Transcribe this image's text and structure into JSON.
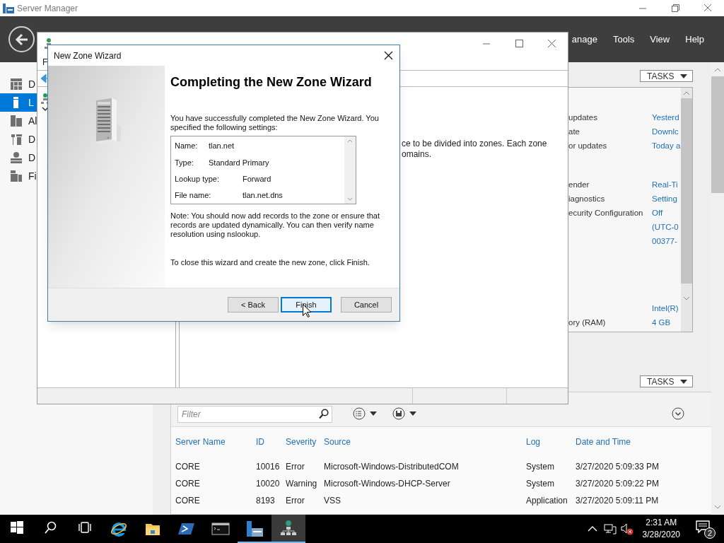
{
  "server_manager": {
    "title": "Server Manager",
    "menu": [
      "anage",
      "Tools",
      "View",
      "Help"
    ],
    "sidebar": [
      {
        "kind": "dashboard",
        "label": "D",
        "selected": false
      },
      {
        "kind": "local",
        "label": "L",
        "selected": true
      },
      {
        "kind": "all",
        "label": "Al",
        "selected": false
      },
      {
        "kind": "dhcp",
        "label": "D",
        "selected": false
      },
      {
        "kind": "dns",
        "label": "D",
        "selected": false
      },
      {
        "kind": "files",
        "label": "Fi",
        "selected": false
      }
    ],
    "properties_tasks": "TASKS",
    "properties": [
      [
        {
          "label": "updates",
          "value": "Yesterd"
        },
        {
          "label": "ate",
          "value": "Downlc"
        },
        {
          "label": "or updates",
          "value": "Today a"
        }
      ],
      [
        {
          "label": "ender",
          "value": "Real-Ti"
        },
        {
          "label": "iagnostics",
          "value": "Setting"
        },
        {
          "label": "ecurity Configuration",
          "value": "Off"
        },
        {
          "value": "(UTC-0"
        },
        {
          "value": "00377-"
        }
      ],
      [
        {
          "value": "Intel(R)"
        },
        {
          "label": "ory (RAM)",
          "value": "4 GB"
        }
      ]
    ],
    "events_tasks": "TASKS",
    "events": {
      "filter_placeholder": "Filter",
      "columns": [
        "Server Name",
        "ID",
        "Severity",
        "Source",
        "Log",
        "Date and Time"
      ],
      "rows": [
        [
          "CORE",
          "10016",
          "Error",
          "Microsoft-Windows-DistributedCOM",
          "System",
          "3/27/2020 5:09:33 PM"
        ],
        [
          "CORE",
          "10020",
          "Warning",
          "Microsoft-Windows-DHCP-Server",
          "System",
          "3/27/2020 5:09:22 PM"
        ],
        [
          "CORE",
          "8193",
          "Error",
          "VSS",
          "Application",
          "3/27/2020 5:09:11 PM"
        ]
      ]
    }
  },
  "dns_manager": {
    "menu": [
      "F"
    ],
    "details_text": [
      "ce to be divided into zones. Each zone",
      "omains."
    ]
  },
  "wizard": {
    "title": "New Zone Wizard",
    "heading": "Completing the New Zone Wizard",
    "intro": "You have successfully completed the New Zone Wizard. You specified the following settings:",
    "settings": [
      {
        "label": "Name:",
        "value": "tlan.net"
      },
      {
        "label": "Type:",
        "value": "Standard Primary"
      },
      {
        "label": "Lookup type:",
        "value": "Forward"
      },
      {
        "label": "File name:",
        "value": "tlan.net.dns"
      }
    ],
    "note": "Note: You should now add records to the zone or ensure that records are updated dynamically. You can then verify name resolution using nslookup.",
    "closing": "To close this wizard and create the new zone, click Finish.",
    "buttons": [
      {
        "label": "< Back",
        "focused": false
      },
      {
        "label": "Finish",
        "focused": true
      },
      {
        "label": "Cancel",
        "focused": false
      }
    ]
  },
  "taskbar": {
    "apps": [
      {
        "kind": "start",
        "running": false,
        "selected": false
      },
      {
        "kind": "search",
        "running": false,
        "selected": false
      },
      {
        "kind": "task-view",
        "running": false,
        "selected": false
      },
      {
        "kind": "ie",
        "running": false,
        "selected": false
      },
      {
        "kind": "explorer",
        "running": false,
        "selected": false
      },
      {
        "kind": "powershell",
        "running": false,
        "selected": false
      },
      {
        "kind": "cmd",
        "running": false,
        "selected": false
      },
      {
        "kind": "server-manager",
        "running": true,
        "selected": false
      },
      {
        "kind": "dns",
        "running": true,
        "selected": true
      }
    ],
    "time": "2:31 AM",
    "date": "3/28/2020",
    "notification_count": "2"
  }
}
